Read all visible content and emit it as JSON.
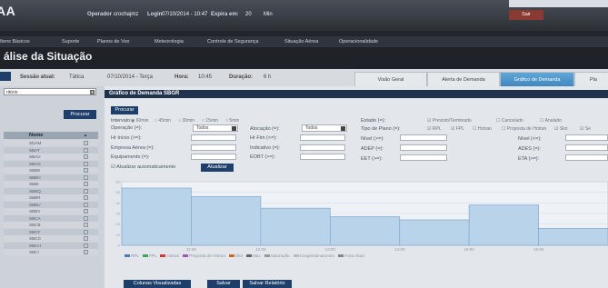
{
  "app": {
    "logo": "AA"
  },
  "header": {
    "operator_label": "Operador",
    "operator_value": "crochajmz",
    "login_label": "Login",
    "login_value": "07/10/2014 - 10:47",
    "expires_label": "Expira em:",
    "expires_value": "20",
    "expires_unit": "Min",
    "logout_label": "Sair"
  },
  "menu": [
    "Itens Básicos",
    "Suporte",
    "Planos de Voo",
    "Meteorologia",
    "Controle de Segurança",
    "Situação Aérea",
    "Operacionalidade"
  ],
  "page_title": "álise da Situação",
  "session": {
    "session_label": "Sessão atual:",
    "session_value": "Tática",
    "date_value": "07/10/2014 - Terça",
    "time_label": "Hora:",
    "time_value": "10:45",
    "duration_label": "Duração:",
    "duration_value": "6 h"
  },
  "tabs": [
    {
      "label": "Visão Geral",
      "active": false
    },
    {
      "label": "Alerta de Demanda",
      "active": false
    },
    {
      "label": "Gráfico de Demanda",
      "active": true
    },
    {
      "label": "Pla",
      "active": false
    }
  ],
  "left_panel": {
    "select_value": "ritório",
    "search_button": "Procurar",
    "list_header": "Nome",
    "sort_marker": "▲",
    "rows": [
      "SDAM",
      "SBAT",
      "SBAU",
      "SBAG",
      "SBBE",
      "SBBH",
      "SBBI",
      "SBBQ",
      "SBBR",
      "SBBU",
      "SBBV",
      "SBCA",
      "SBCB",
      "SBCF",
      "SBCG",
      "SBCH",
      "SBCI"
    ]
  },
  "graph_panel": {
    "title": "Gráfico de Demanda SBGR",
    "search_button": "Procurar",
    "interval_label": "Intervalo:",
    "intervals": [
      "60min",
      "45min",
      "30min",
      "15min",
      "5min"
    ],
    "operation_label": "Operação (=):",
    "operation_value": "Todos",
    "allocation_label": "Alocação (=):",
    "allocation_value": "Todos",
    "hr_start_label": "Hr Início (>=):",
    "hr_end_label": "Hr Fim (<=):",
    "airline_label": "Empresa Aérea (=):",
    "indicative_label": "Indicativo (=):",
    "equipment_label": "Equipamento (=):",
    "eobt_label": "EOBT (>=):",
    "auto_update_label": "Atualizar automaticamente",
    "update_button": "Atualizar",
    "state_label": "Estado (=):",
    "states": [
      "Previsto/Terminado",
      "Cancelado",
      "Anulado"
    ],
    "plan_type_label": "Tipo de Plano (=):",
    "plan_types": [
      "RPL",
      "FPL",
      "Hotran",
      "Proposta de Hotran",
      "Slot",
      "Se"
    ],
    "level_label": "Nível (>=):",
    "adep_label": "ADEP (=):",
    "eet_label": "EET (>=):",
    "level2_label": "Nível (<=):",
    "ades_label": "ADES (=):",
    "eta_label": "ETA (>=):"
  },
  "chart_data": {
    "type": "bar",
    "ylim": [
      0,
      60
    ],
    "yticks": [
      0,
      10,
      20,
      30,
      40,
      50,
      60
    ],
    "x_tick_labels": [
      "11:00",
      "12:00",
      "13:00",
      "14:00",
      "15:00",
      "16:00"
    ],
    "categories": [
      "10:00",
      "11:00",
      "12:00",
      "13:00",
      "14:00",
      "15:00",
      "16:00"
    ],
    "values": [
      54,
      46,
      35,
      27,
      24,
      38,
      16
    ],
    "legend": [
      "RPL",
      "FPL",
      "Hotran",
      "Proposta de Hotran",
      "Slot",
      "Max",
      "Saturação",
      "Congestionamento",
      "Hora Atual"
    ],
    "colors": {
      "bar_fill": "#b9d3ea",
      "bar_stroke": "#7fa9cf"
    }
  },
  "bottom_buttons": [
    "Colunas Visualizadas",
    "Salvar",
    "Salvar Relatório"
  ]
}
